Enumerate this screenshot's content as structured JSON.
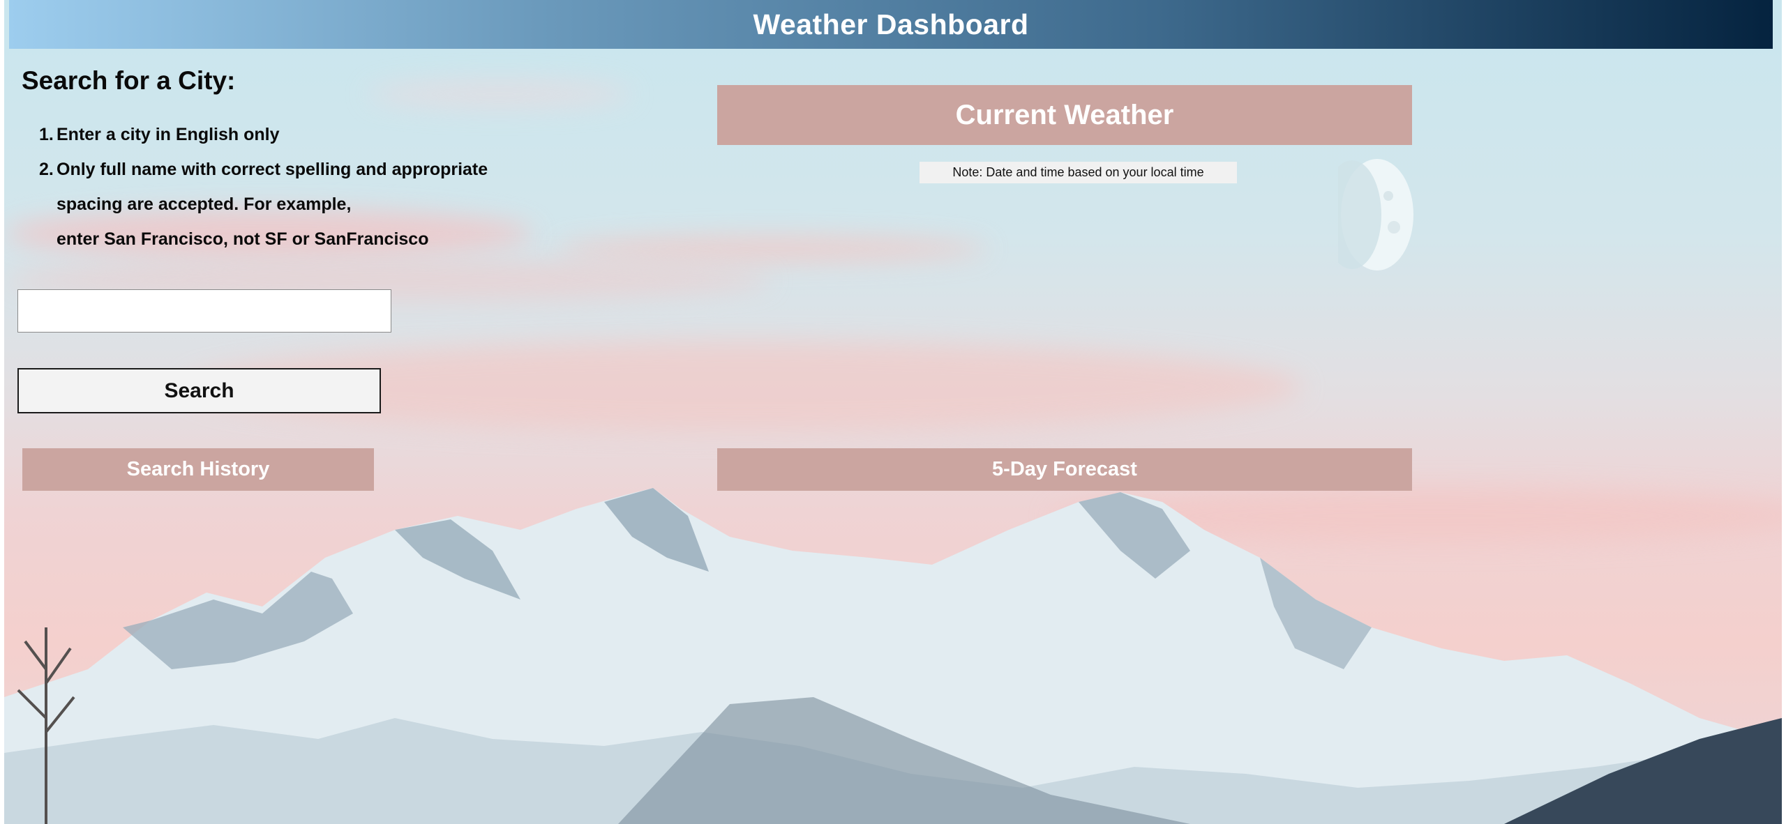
{
  "header": {
    "title": "Weather Dashboard"
  },
  "search": {
    "heading": "Search for a City:",
    "instructions": [
      {
        "number": "1.",
        "text": "Enter a city in English only"
      },
      {
        "number": "2.",
        "text": "Only full name with correct spelling and appropriate"
      }
    ],
    "instruction_continuation": [
      "spacing are accepted. For example,",
      "enter San Francisco, not SF or SanFrancisco"
    ],
    "input_value": "",
    "button_label": "Search"
  },
  "history": {
    "title": "Search History"
  },
  "current_weather": {
    "title": "Current Weather",
    "note": "Note: Date and time based on your local time"
  },
  "forecast": {
    "title": "5-Day Forecast"
  },
  "colors": {
    "panel_background": "#cba5a0",
    "header_gradient_start": "#9dcdee",
    "header_gradient_end": "#05233f"
  }
}
